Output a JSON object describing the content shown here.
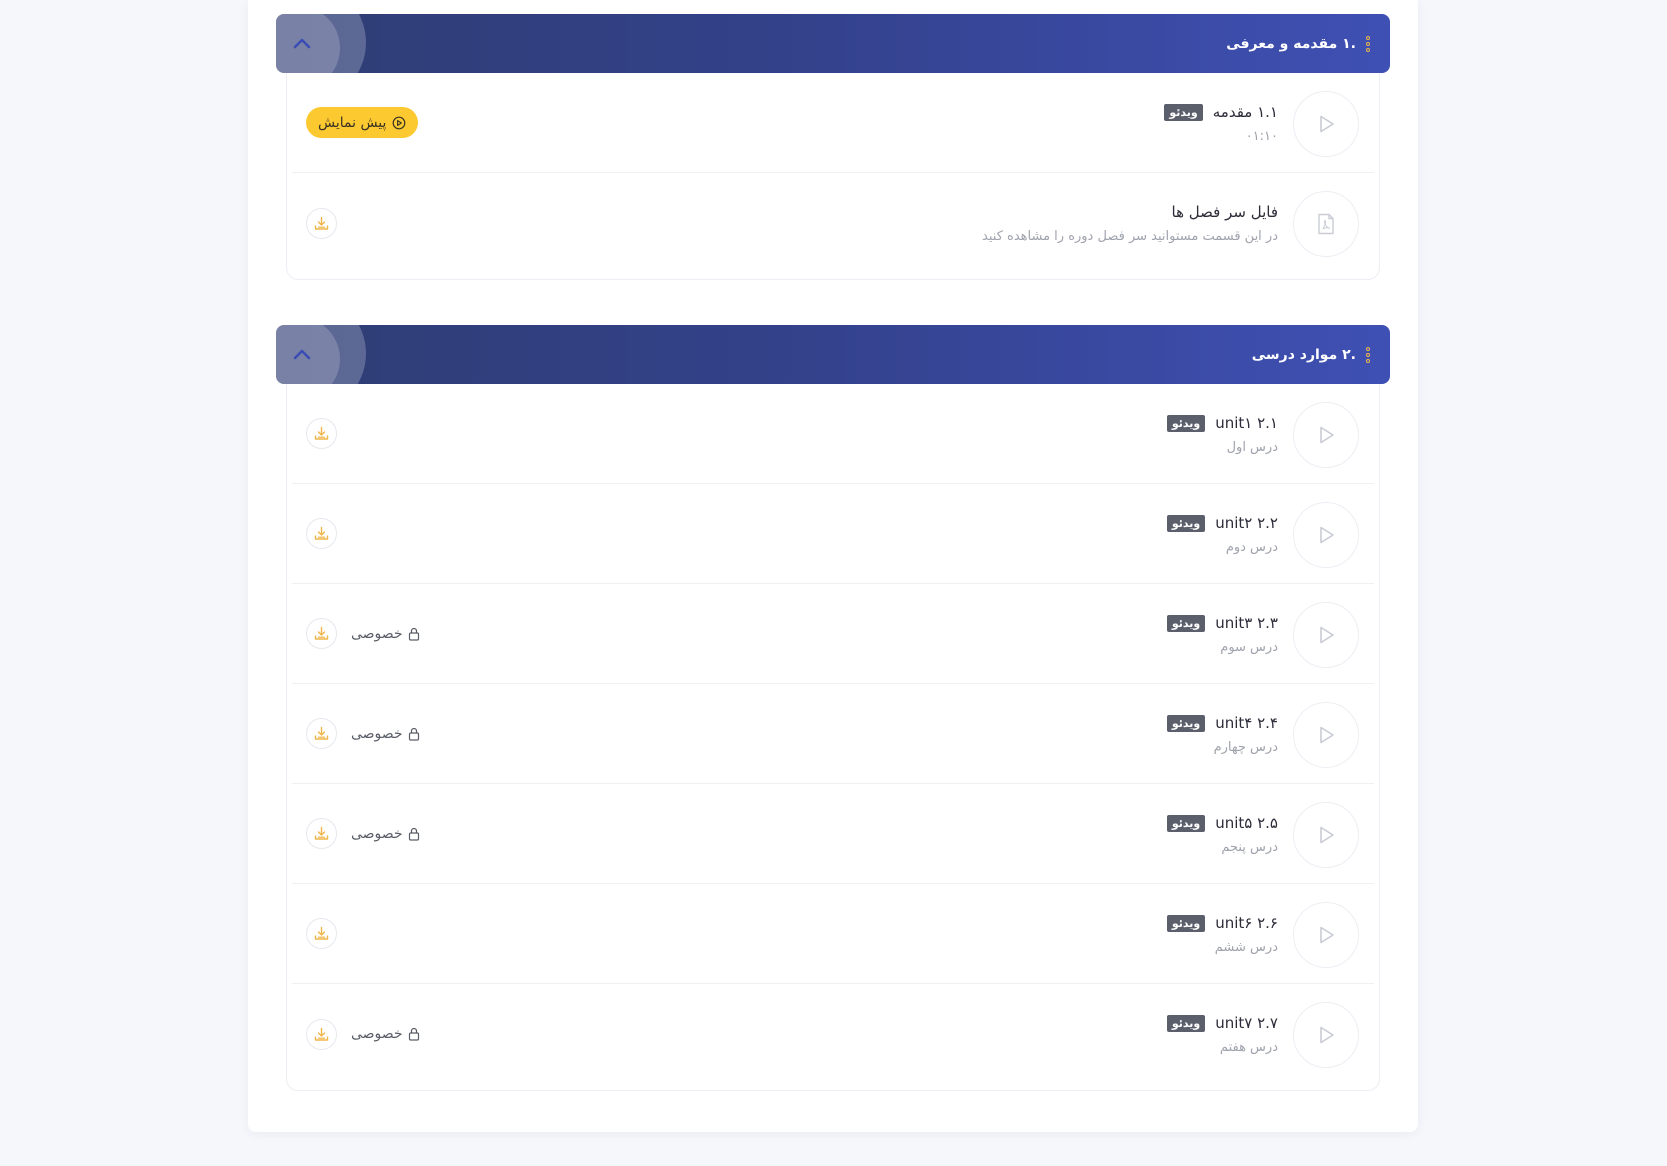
{
  "colors": {
    "header_gradient_start": "#2f3d74",
    "header_gradient_end": "#3f50b4",
    "accent_yellow": "#fdc931",
    "badge_gray": "#5b5f6b",
    "download_icon": "#f0b54a"
  },
  "sections": [
    {
      "title": ".۱ مقدمه و معرفی",
      "lessons": [
        {
          "icon": "play-icon",
          "title": "۱.۱ مقدمه",
          "badge": "ویدئو",
          "subtitle": "۰۱:۱۰",
          "action": "preview",
          "preview_label": "پیش نمایش",
          "private": false
        },
        {
          "icon": "pdf-icon",
          "title": "فایل سر فصل ها",
          "badge": "",
          "subtitle": "در این قسمت مستوانید سر فصل دوره را مشاهده کنید",
          "action": "download",
          "private": false
        }
      ]
    },
    {
      "title": ".۲ موارد درسی",
      "lessons": [
        {
          "icon": "play-icon",
          "title": "۲.۱ unit۱",
          "badge": "ویدئو",
          "subtitle": "درس اول",
          "action": "download",
          "private": false
        },
        {
          "icon": "play-icon",
          "title": "۲.۲ unit۲",
          "badge": "ویدئو",
          "subtitle": "درس دوم",
          "action": "download",
          "private": false
        },
        {
          "icon": "play-icon",
          "title": "۲.۳ unit۳",
          "badge": "ویدئو",
          "subtitle": "درس سوم",
          "action": "download",
          "private": true
        },
        {
          "icon": "play-icon",
          "title": "۲.۴ unit۴",
          "badge": "ویدئو",
          "subtitle": "درس چهارم",
          "action": "download",
          "private": true
        },
        {
          "icon": "play-icon",
          "title": "۲.۵ unit۵",
          "badge": "ویدئو",
          "subtitle": "درس پنجم",
          "action": "download",
          "private": true
        },
        {
          "icon": "play-icon",
          "title": "۲.۶ unit۶",
          "badge": "ویدئو",
          "subtitle": "درس ششم",
          "action": "download",
          "private": false
        },
        {
          "icon": "play-icon",
          "title": "۲.۷ unit۷",
          "badge": "ویدئو",
          "subtitle": "درس هفتم",
          "action": "download",
          "private": true
        }
      ]
    }
  ],
  "private_label": "خصوصی"
}
